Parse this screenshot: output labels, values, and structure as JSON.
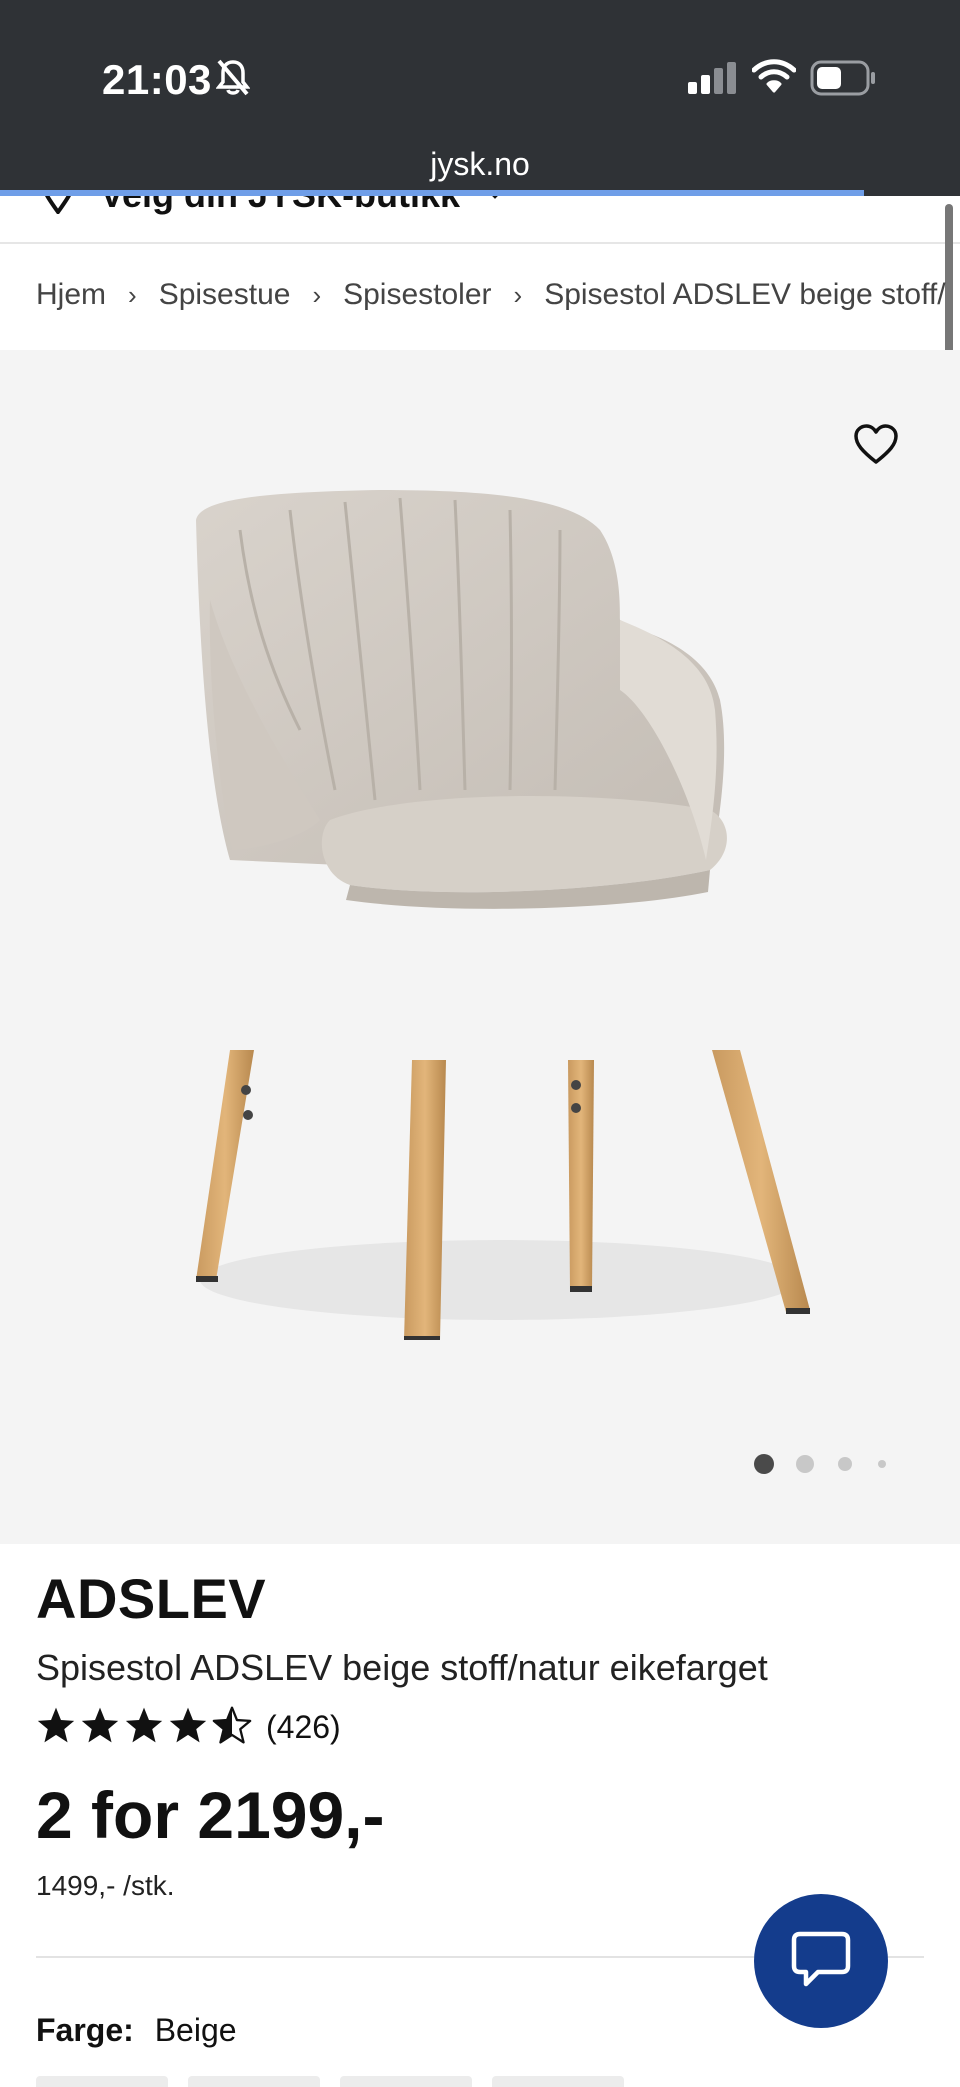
{
  "status_bar": {
    "time": "21:03",
    "icons": [
      "bell-slash-icon",
      "signal-icon",
      "wifi-icon",
      "battery-icon"
    ]
  },
  "browser": {
    "url": "jysk.no",
    "load_progress": 0.9
  },
  "store": {
    "label": "Velg din JYSK-butikk"
  },
  "breadcrumb": {
    "items": [
      "Hjem",
      "Spisestue",
      "Spisestoler",
      "Spisestol ADSLEV beige stoff/"
    ]
  },
  "gallery": {
    "image_count": 4,
    "active_index": 0
  },
  "product": {
    "brand": "ADSLEV",
    "name": "Spisestol ADSLEV beige stoff/natur eikefarget",
    "rating": 4.5,
    "rating_count": "(426)",
    "price": "2 for 2199,-",
    "unit_price": "1499,- /stk.",
    "color_label": "Farge:",
    "color_value": "Beige"
  },
  "colors": {
    "chrome_bg": "#2f3236",
    "gallery_bg": "#f4f4f4",
    "chat_button": "#143c8c",
    "progress": "#6f9ee8"
  }
}
